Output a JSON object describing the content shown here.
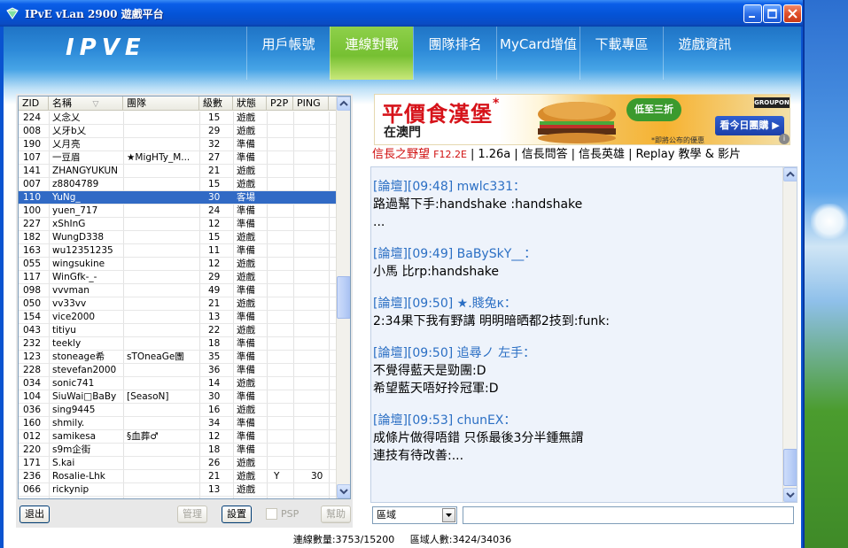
{
  "window": {
    "title": "IPvE vLan 2900 遊戲平台"
  },
  "nav": {
    "logo_text": "IPVE",
    "items": [
      {
        "label": "用戶帳號"
      },
      {
        "label": "連線對戰"
      },
      {
        "label": "團隊排名"
      },
      {
        "label": "MyCard增值"
      },
      {
        "label": "下載專區"
      },
      {
        "label": "遊戲資訊"
      }
    ]
  },
  "grid": {
    "headers": {
      "zid": "ZID",
      "name": "名稱",
      "team": "團隊",
      "level": "級數",
      "status": "狀態",
      "p2p": "P2P",
      "ping": "PING"
    },
    "rows": [
      {
        "zid": "224",
        "name": "乂念乂",
        "team": "",
        "level": "15",
        "status": "遊戲",
        "p2p": "",
        "ping": ""
      },
      {
        "zid": "008",
        "name": "乂牙b乂",
        "team": "",
        "level": "29",
        "status": "遊戲",
        "p2p": "",
        "ping": ""
      },
      {
        "zid": "190",
        "name": "乂月亮",
        "team": "",
        "level": "32",
        "status": "準備",
        "p2p": "",
        "ping": ""
      },
      {
        "zid": "107",
        "name": "一豆眉",
        "team": "★MigHTy_M...",
        "level": "27",
        "status": "準備",
        "p2p": "",
        "ping": ""
      },
      {
        "zid": "141",
        "name": "ZHANGYUKUN",
        "team": "",
        "level": "21",
        "status": "遊戲",
        "p2p": "",
        "ping": ""
      },
      {
        "zid": "007",
        "name": "z8804789",
        "team": "",
        "level": "15",
        "status": "遊戲",
        "p2p": "",
        "ping": ""
      },
      {
        "zid": "110",
        "name": "YuNg_",
        "team": "",
        "level": "30",
        "status": "客場",
        "p2p": "",
        "ping": ""
      },
      {
        "zid": "100",
        "name": "yuen_717",
        "team": "",
        "level": "24",
        "status": "準備",
        "p2p": "",
        "ping": ""
      },
      {
        "zid": "227",
        "name": "xShInG",
        "team": "",
        "level": "12",
        "status": "準備",
        "p2p": "",
        "ping": ""
      },
      {
        "zid": "182",
        "name": "WungD338",
        "team": "",
        "level": "15",
        "status": "遊戲",
        "p2p": "",
        "ping": ""
      },
      {
        "zid": "163",
        "name": "wu12351235",
        "team": "",
        "level": "11",
        "status": "準備",
        "p2p": "",
        "ping": ""
      },
      {
        "zid": "055",
        "name": "wingsukine",
        "team": "",
        "level": "12",
        "status": "遊戲",
        "p2p": "",
        "ping": ""
      },
      {
        "zid": "117",
        "name": "WinGfk-_-",
        "team": "",
        "level": "29",
        "status": "遊戲",
        "p2p": "",
        "ping": ""
      },
      {
        "zid": "098",
        "name": "vvvman",
        "team": "",
        "level": "49",
        "status": "準備",
        "p2p": "",
        "ping": ""
      },
      {
        "zid": "050",
        "name": "vv33vv",
        "team": "",
        "level": "21",
        "status": "遊戲",
        "p2p": "",
        "ping": ""
      },
      {
        "zid": "154",
        "name": "vice2000",
        "team": "",
        "level": "13",
        "status": "準備",
        "p2p": "",
        "ping": ""
      },
      {
        "zid": "043",
        "name": "titiyu",
        "team": "",
        "level": "22",
        "status": "遊戲",
        "p2p": "",
        "ping": ""
      },
      {
        "zid": "232",
        "name": "teekly",
        "team": "",
        "level": "18",
        "status": "準備",
        "p2p": "",
        "ping": ""
      },
      {
        "zid": "123",
        "name": "stoneage希",
        "team": "sTOneaGe團",
        "level": "35",
        "status": "準備",
        "p2p": "",
        "ping": ""
      },
      {
        "zid": "228",
        "name": "stevefan2000",
        "team": "",
        "level": "36",
        "status": "準備",
        "p2p": "",
        "ping": ""
      },
      {
        "zid": "034",
        "name": "sonic741",
        "team": "",
        "level": "14",
        "status": "遊戲",
        "p2p": "",
        "ping": ""
      },
      {
        "zid": "104",
        "name": "SiuWai□BaBy",
        "team": "[SeasoN]",
        "level": "30",
        "status": "準備",
        "p2p": "",
        "ping": ""
      },
      {
        "zid": "036",
        "name": "sing9445",
        "team": "",
        "level": "16",
        "status": "遊戲",
        "p2p": "",
        "ping": ""
      },
      {
        "zid": "160",
        "name": "shmily.",
        "team": "",
        "level": "34",
        "status": "準備",
        "p2p": "",
        "ping": ""
      },
      {
        "zid": "012",
        "name": "samikesa",
        "team": "§血葬♂",
        "level": "12",
        "status": "準備",
        "p2p": "",
        "ping": ""
      },
      {
        "zid": "220",
        "name": "s9m企街",
        "team": "",
        "level": "18",
        "status": "準備",
        "p2p": "",
        "ping": ""
      },
      {
        "zid": "171",
        "name": "S.kai",
        "team": "",
        "level": "26",
        "status": "遊戲",
        "p2p": "",
        "ping": ""
      },
      {
        "zid": "236",
        "name": "Rosalie-Lhk",
        "team": "",
        "level": "21",
        "status": "遊戲",
        "p2p": "Y",
        "ping": "30"
      },
      {
        "zid": "066",
        "name": "rickynip",
        "team": "",
        "level": "13",
        "status": "遊戲",
        "p2p": "",
        "ping": ""
      }
    ]
  },
  "left_toolbar": {
    "exit_label": "退出",
    "manage_label": "管理",
    "settings_label": "設置",
    "psp_label": "PSP",
    "help_label": "幫助"
  },
  "banner": {
    "title": "平價食漢堡",
    "subtitle": "在澳門",
    "badge": "低至三折",
    "brand": "GROUPON",
    "cta": "看今日團購",
    "note": "*即將公布的優惠"
  },
  "links": {
    "game_title": "信長之野望",
    "version_tag": "F12.2E",
    "item1": "1.26a",
    "item2": "信長問答",
    "item3": "信長英雄",
    "item4": "Replay 教學 & 影片"
  },
  "chat": {
    "messages": [
      {
        "head": "[論壇][09:48] mwlc331：",
        "lines": [
          "路過幫下手:handshake :handshake",
          "..."
        ]
      },
      {
        "head": "[論壇][09:49] BaBySkY__：",
        "lines": [
          "小馬 比rp:handshake"
        ]
      },
      {
        "head": "[論壇][09:50] ★.賤兔κ：",
        "lines": [
          "2:34果下我有野講 明明暗晒都2技到:funk:"
        ]
      },
      {
        "head": "[論壇][09:50] 追尋ノ 左手：",
        "lines": [
          "不覺得藍天是勁團:D",
          "希望藍天唔好拎冠軍:D"
        ]
      },
      {
        "head": "[論壇][09:53] chunEX：",
        "lines": [
          "成條片做得唔錯  只係最後3分半鍾無謂",
          "連技有待改善:..."
        ]
      }
    ]
  },
  "input": {
    "region_label": "區域",
    "chat_value": ""
  },
  "status": {
    "connections": "連線數量:3753/15200",
    "region_users": "區域人數:3424/34036"
  }
}
